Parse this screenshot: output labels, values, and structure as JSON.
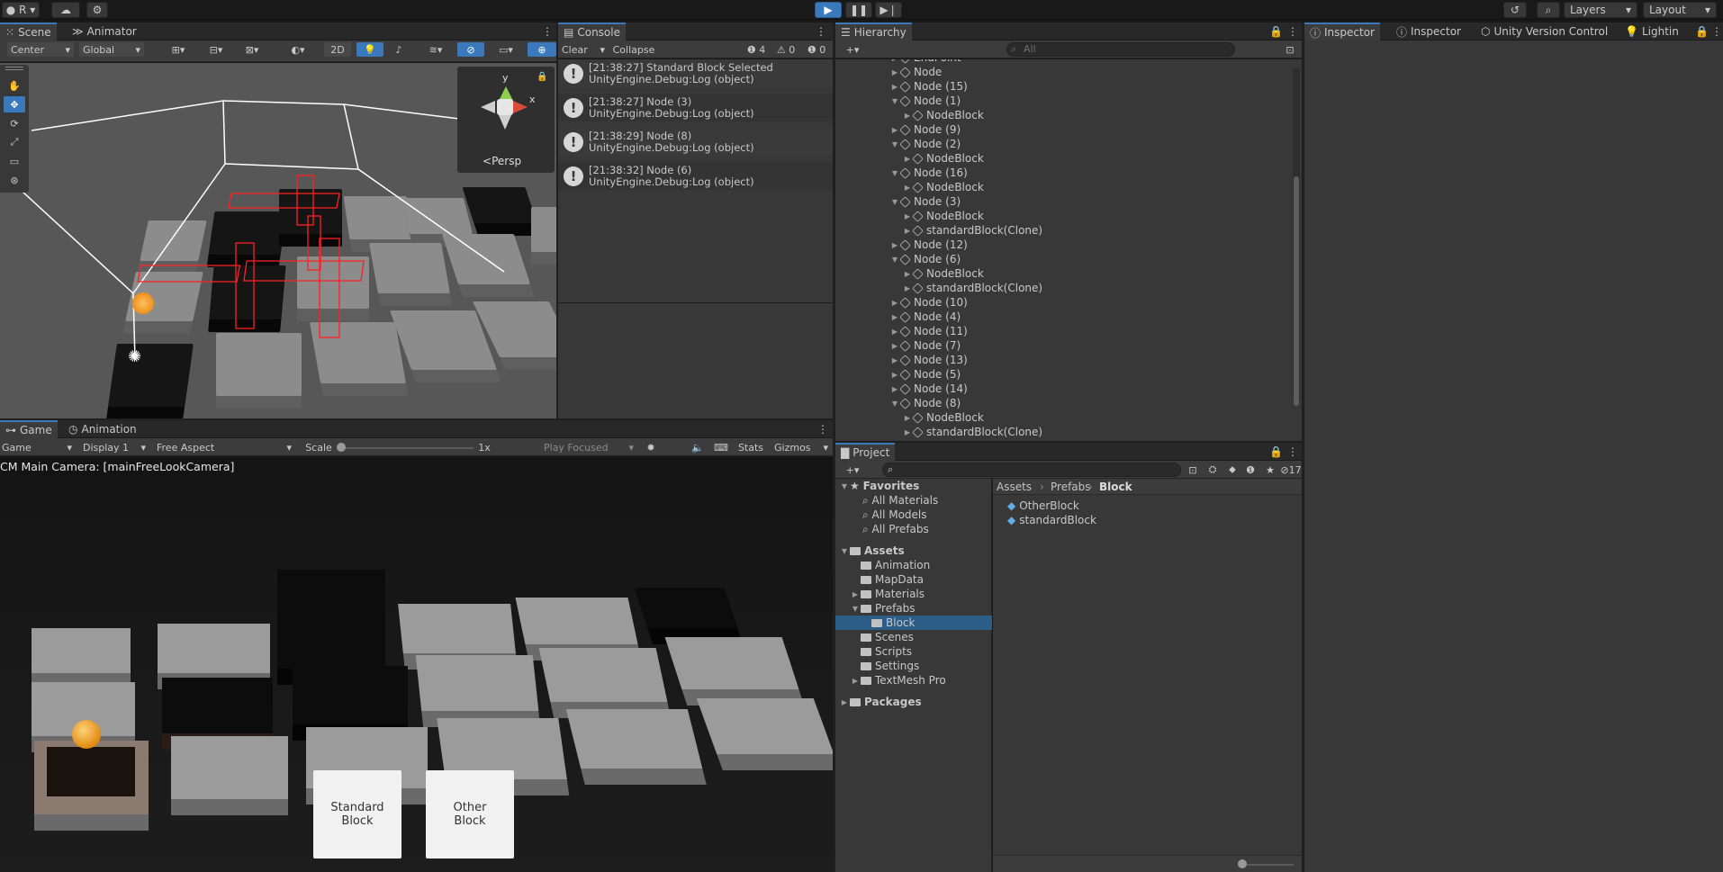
{
  "topbar": {
    "account": "R",
    "play_state": "playing",
    "layers": "Layers",
    "layout": "Layout"
  },
  "scene": {
    "tabs": [
      "Scene",
      "Animator"
    ],
    "pivot": "Center",
    "space": "Global",
    "mode2d": "2D",
    "gizmo_label": "Persp"
  },
  "console": {
    "tab": "Console",
    "clear": "Clear",
    "collapse": "Collapse",
    "counts": {
      "log": "4",
      "warn": "0",
      "error": "0"
    },
    "entries": [
      {
        "line1": "[21:38:27] Standard Block Selected",
        "line2": "UnityEngine.Debug:Log (object)"
      },
      {
        "line1": "[21:38:27] Node (3)",
        "line2": "UnityEngine.Debug:Log (object)"
      },
      {
        "line1": "[21:38:29] Node (8)",
        "line2": "UnityEngine.Debug:Log (object)"
      },
      {
        "line1": "[21:38:32] Node (6)",
        "line2": "UnityEngine.Debug:Log (object)"
      }
    ]
  },
  "hierarchy": {
    "tab": "Hierarchy",
    "search_placeholder": "All",
    "items": [
      {
        "label": "EndPoint",
        "indent": 0,
        "expanded": false
      },
      {
        "label": "Node",
        "indent": 0,
        "expanded": false
      },
      {
        "label": "Node (15)",
        "indent": 0,
        "expanded": false
      },
      {
        "label": "Node (1)",
        "indent": 0,
        "expanded": true
      },
      {
        "label": "NodeBlock",
        "indent": 1,
        "expanded": false
      },
      {
        "label": "Node (9)",
        "indent": 0,
        "expanded": false
      },
      {
        "label": "Node (2)",
        "indent": 0,
        "expanded": true
      },
      {
        "label": "NodeBlock",
        "indent": 1,
        "expanded": false
      },
      {
        "label": "Node (16)",
        "indent": 0,
        "expanded": true
      },
      {
        "label": "NodeBlock",
        "indent": 1,
        "expanded": false
      },
      {
        "label": "Node (3)",
        "indent": 0,
        "expanded": true
      },
      {
        "label": "NodeBlock",
        "indent": 1,
        "expanded": false
      },
      {
        "label": "standardBlock(Clone)",
        "indent": 1,
        "expanded": false
      },
      {
        "label": "Node (12)",
        "indent": 0,
        "expanded": false
      },
      {
        "label": "Node (6)",
        "indent": 0,
        "expanded": true
      },
      {
        "label": "NodeBlock",
        "indent": 1,
        "expanded": false
      },
      {
        "label": "standardBlock(Clone)",
        "indent": 1,
        "expanded": false
      },
      {
        "label": "Node (10)",
        "indent": 0,
        "expanded": false
      },
      {
        "label": "Node (4)",
        "indent": 0,
        "expanded": false
      },
      {
        "label": "Node (11)",
        "indent": 0,
        "expanded": false
      },
      {
        "label": "Node (7)",
        "indent": 0,
        "expanded": false
      },
      {
        "label": "Node (13)",
        "indent": 0,
        "expanded": false
      },
      {
        "label": "Node (5)",
        "indent": 0,
        "expanded": false
      },
      {
        "label": "Node (14)",
        "indent": 0,
        "expanded": false
      },
      {
        "label": "Node (8)",
        "indent": 0,
        "expanded": true
      },
      {
        "label": "NodeBlock",
        "indent": 1,
        "expanded": false
      },
      {
        "label": "standardBlock(Clone)",
        "indent": 1,
        "expanded": false
      }
    ]
  },
  "inspector": {
    "tabs": [
      "Inspector",
      "Inspector",
      "Unity Version Control",
      "Lightin"
    ]
  },
  "game": {
    "tabs": [
      "Game",
      "Animation"
    ],
    "display_mode": "Game",
    "display": "Display 1",
    "aspect": "Free Aspect",
    "scale_label": "Scale",
    "scale_value": "1x",
    "play_focus": "Play Focused",
    "stats": "Stats",
    "gizmos": "Gizmos",
    "camera_label": "CM Main Camera: [mainFreeLookCamera]",
    "buttons": [
      {
        "label": "Standard\nBlock"
      },
      {
        "label": "Other\nBlock"
      }
    ]
  },
  "project": {
    "tab": "Project",
    "hidden_count": "17",
    "favorites": {
      "title": "Favorites",
      "items": [
        "All Materials",
        "All Models",
        "All Prefabs"
      ]
    },
    "assets": {
      "title": "Assets",
      "items": [
        {
          "label": "Animation",
          "indent": 1,
          "arrow": false,
          "selected": false
        },
        {
          "label": "MapData",
          "indent": 1,
          "arrow": false,
          "selected": false
        },
        {
          "label": "Materials",
          "indent": 1,
          "arrow": true,
          "selected": false
        },
        {
          "label": "Prefabs",
          "indent": 1,
          "arrow": true,
          "selected": false
        },
        {
          "label": "Block",
          "indent": 2,
          "arrow": false,
          "selected": true
        },
        {
          "label": "Scenes",
          "indent": 1,
          "arrow": false,
          "selected": false
        },
        {
          "label": "Scripts",
          "indent": 1,
          "arrow": false,
          "selected": false
        },
        {
          "label": "Settings",
          "indent": 1,
          "arrow": false,
          "selected": false
        },
        {
          "label": "TextMesh Pro",
          "indent": 1,
          "arrow": true,
          "selected": false
        }
      ]
    },
    "packages": "Packages",
    "breadcrumb": [
      "Assets",
      "Prefabs",
      "Block"
    ],
    "files": [
      "OtherBlock",
      "standardBlock"
    ]
  },
  "colors": {
    "accent": "#3a79bb",
    "panel": "#383838",
    "selection": "#2c5d87"
  }
}
